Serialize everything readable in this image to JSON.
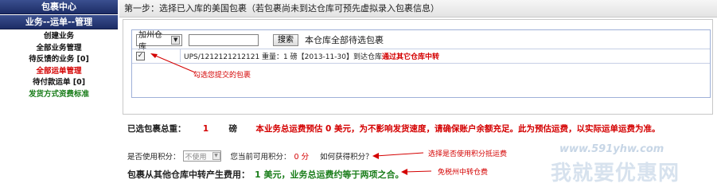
{
  "sidebar": {
    "header1": "包裹中心",
    "header2": "业务--运单--管理",
    "items": [
      {
        "label": "创建业务",
        "color": "#111111"
      },
      {
        "label": "全部业务管理",
        "color": "#111111"
      },
      {
        "label": "待反馈的业务 [0]",
        "color": "#111111"
      },
      {
        "label": "全部运单管理",
        "color": "#d40000"
      },
      {
        "label": "待付款运单 [0]",
        "color": "#111111"
      },
      {
        "label": "发货方式资费标准",
        "color": "#1a7d1a"
      }
    ]
  },
  "main": {
    "step_title": "第一步：选择已入库的美国包裹（若包裹尚未到达仓库可预先虚拟录入包裹信息）",
    "warehouse_select": "加州仓库",
    "search_value": "",
    "search_button": "搜索",
    "all_packages_label": "本仓库全部待选包裹",
    "package_row": {
      "checked": true,
      "info": "UPS/1212121212121  重量：1 磅【2013-11-30】到达仓库",
      "notice": "通过其它仓库中转"
    },
    "annotation_check": "勾选您提交的包裹",
    "summary": {
      "label": "已选包裹总重：",
      "weight": "1",
      "unit": "磅",
      "note": "本业务总运费预估 0 美元，为不影响发货速度，请确保账户余额充足。此为预估运费，以实际运单运费为准。"
    },
    "points": {
      "use_label": "是否使用积分：",
      "use_select": "不使用",
      "available_label": "您当前可用积分：",
      "available_value": "0 分",
      "how_link": "如何获得积分？"
    },
    "annotation_points": "选择是否使用积分抵运费",
    "transfer": {
      "label": "包裹从其他仓库中转产生费用：",
      "value": "1 美元，业务总运费约等于两项之合。"
    },
    "annotation_transfer": "免税州中转仓费"
  },
  "watermark": {
    "url": "www.591yhw.com",
    "cn": "我就要优惠网"
  },
  "colors": {
    "accent_red": "#d40000",
    "accent_green": "#1a7d1a",
    "sidebar_header": "#1d2d66"
  }
}
